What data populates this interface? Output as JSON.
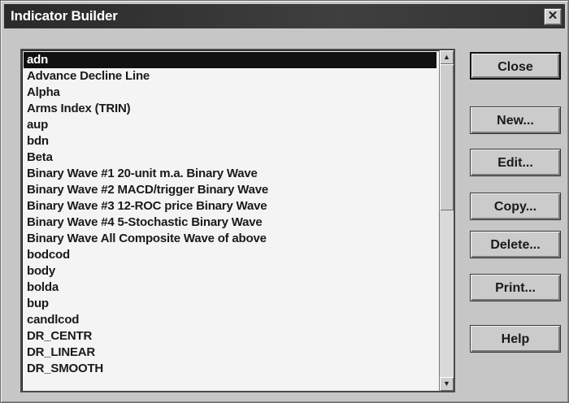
{
  "window": {
    "title": "Indicator Builder",
    "close_glyph": "✕"
  },
  "list": {
    "items": [
      "adn",
      "Advance Decline Line",
      "Alpha",
      "Arms Index (TRIN)",
      "aup",
      "bdn",
      "Beta",
      "Binary Wave #1  20-unit m.a. Binary Wave",
      "Binary Wave #2  MACD/trigger Binary Wave",
      "Binary Wave #3  12-ROC price Binary Wave",
      "Binary Wave #4  5-Stochastic Binary Wave",
      "Binary Wave All  Composite Wave of above",
      "bodcod",
      "body",
      "bolda",
      "bup",
      "candlcod",
      "DR_CENTR",
      "DR_LINEAR",
      "DR_SMOOTH"
    ],
    "selected_index": 0,
    "scroll_up_glyph": "▲",
    "scroll_down_glyph": "▼"
  },
  "buttons": {
    "close": "Close",
    "new": "New...",
    "edit": "Edit...",
    "copy": "Copy...",
    "delete": "Delete...",
    "print": "Print...",
    "help": "Help"
  }
}
